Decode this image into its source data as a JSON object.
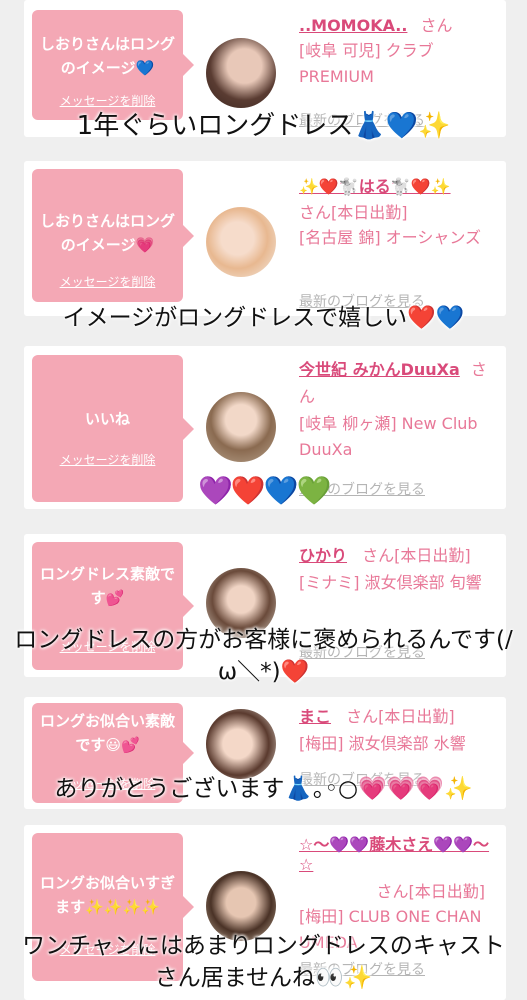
{
  "cards": [
    {
      "message": "しおりさんはロングのイメージ💙",
      "delete_label": "メッセージを削除",
      "name": "..MOMOKA..",
      "san": "さん",
      "shop": "[岐阜 可児] クラブPREMIUM",
      "blog_label": "最新のブログを見る"
    },
    {
      "message": "しおりさんはロングのイメージ💗",
      "delete_label": "メッセージを削除",
      "name": "✨❤️🐩はる🐩❤️✨",
      "san": "さん[本日出勤]",
      "shop": "[名古屋 錦] オーシャンズ",
      "blog_label": "最新のブログを見る"
    },
    {
      "message": "いいね",
      "delete_label": "メッセージを削除",
      "name": "今世紀 みかんDuuXa",
      "san": "さん",
      "shop": "[岐阜 柳ヶ瀬] New Club DuuXa",
      "blog_label": "最新のブログを見る"
    },
    {
      "message": "ロングドレス素敵です💕",
      "delete_label": "メッセージを削除",
      "name": "ひかり",
      "san": "さん[本日出勤]",
      "shop": "[ミナミ] 淑女倶楽部 旬響",
      "blog_label": "最新のブログを見る"
    },
    {
      "message": "ロングお似合い素敵です😃💕",
      "delete_label": "メッセージを削除",
      "name": "まこ",
      "san": "さん[本日出勤]",
      "shop": "[梅田] 淑女倶楽部 水響",
      "blog_label": "最新のブログを見る"
    },
    {
      "message": "ロングお似合いすぎます✨✨✨✨",
      "delete_label": "メッセージを削除",
      "name": "☆〜💜💜藤木さえ💜💜〜☆",
      "san": "さん[本日出勤]",
      "shop": "[梅田] CLUB ONE CHAN UMEDA",
      "blog_label": "最新のブログを見る"
    }
  ],
  "captions": {
    "c1": "1年ぐらいロングドレス👗💙✨",
    "c2": "イメージがロングドレスで嬉しい❤️💙",
    "c3": "💜❤️💙💚",
    "c4": "ロングドレスの方がお客様に褒められるんです(/ω＼*)❤️",
    "c5": "ありがとうございます👗｡◦○💗💗💗✨",
    "c6": "ワンチャンにはあまりロングドレスのキャストさん居ませんね👀✨"
  }
}
